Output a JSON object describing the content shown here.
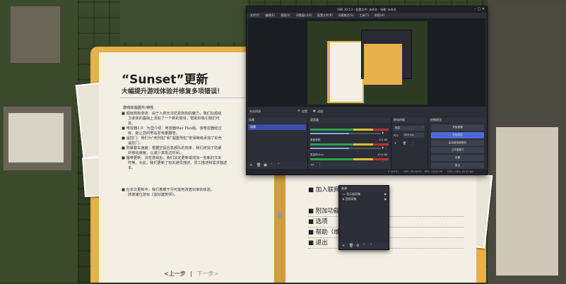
{
  "book": {
    "title": "“Sunset”更新",
    "subtitle": "大幅提升游戏体验并修复多项错误！",
    "section": "游戏体验提升/特性",
    "bullets": [
      "超级狗狗变体：由于人类无法抗拒狗狗的魅力，我们在超级",
      "卫变体的基础上添加了一个新的变体，帮助你吸引我们可",
      "友。",
      "电容器2.0：为您介绍：电容器Max Plus版。该电容器经过",
      "级，能让您的电站发电量翻倍。",
      "遥控门：我们为“死刑犯”和“超重刑犯”安保等级添加了彩色",
      "遥控门。",
      "防暴警车速度：根据空投应急部队的效率，我们增加了防暴",
      "的移动速度，以减少其抵达时间。",
      "履带更新：浏览游戏后，我们决定更新或增加一些新的文本",
      "符等。为此，我们更新了有关通员描述、员工描述和需求描述",
      "本。"
    ],
    "extra": [
      "在本次更新中，我们着眼于尽可能地改善玩家的体验。",
      "感谢诸位游玩《监狱建筑师》。"
    ],
    "nav_prev": "<上一步",
    "nav_sep": "|",
    "nav_next": "下一步>",
    "right_items": [
      "加入联网",
      "附加功能",
      "选项",
      "帮助（维",
      "退出"
    ]
  },
  "obs": {
    "title": "OBS 30.1.2 - 配置文件: 未命名 - 场景: 未命名",
    "menu": [
      "文件(F)",
      "编辑(E)",
      "视图(V)",
      "停靠窗口(D)",
      "配置文件(P)",
      "场景集合(S)",
      "工具(T)",
      "帮助(H)"
    ],
    "source_label": "未选择源",
    "settings_btn": "设置",
    "filters_btn": "滤镜",
    "docks": {
      "scenes": {
        "title": "场景",
        "items": [
          "场景"
        ]
      },
      "mixer": {
        "title": "混音器",
        "tracks": [
          {
            "name": "",
            "value": "",
            "fill": 0.55
          },
          {
            "name": "桌面音频",
            "value": "0.0 dB",
            "fill": 0.55
          },
          {
            "name": "麦克风/Aux",
            "value": "-10.0 dB",
            "fill": 0.45
          }
        ]
      },
      "transitions": {
        "title": "转场特效",
        "type": "渐变",
        "duration_label": "时长",
        "duration": "300 ms"
      },
      "controls": {
        "title": "控制按钮",
        "buttons": [
          "开始直播",
          "开始录制",
          "启动虚拟摄像机",
          "工作室模式",
          "设置",
          "退出"
        ],
        "active_index": 1
      }
    },
    "status": {
      "drop": "0 (0.0%)",
      "live": "LIVE: 00:00:00",
      "rec": "REC: 00:00:00",
      "cpu": "CPU: 0.6%, 60.00 fps"
    }
  },
  "sources_popup": {
    "title": "来源",
    "items": [
      "显示器采集",
      "音频采集"
    ]
  },
  "colors": {
    "obs_bg": "#272a33",
    "obs_accent": "#4f6ad8",
    "folder": "#e6b04a",
    "paper": "#f3efe5"
  }
}
